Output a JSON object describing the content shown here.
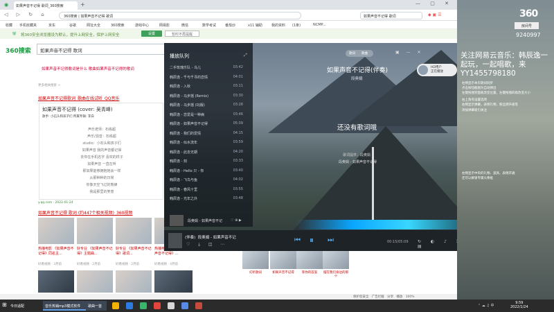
{
  "browser": {
    "tab_title": "如果声音不记得 歌词_360搜索",
    "address": "360搜索  |  如果声音不记得 歌词",
    "search_box": "如果声音不记得 歌词",
    "window_controls": "— ▢ ✕",
    "nav_icons": "◁ ▷ ↻ ⌂",
    "bookmarks": [
      "收藏",
      "手机收藏夹",
      "京东",
      "谷歌",
      "网址大全",
      "360搜索",
      "游戏中心",
      "网易影",
      "微信",
      "数学考试",
      "番茄炒",
      "x11 辅助",
      "我的资料",
      "(1条)",
      "NCMP..."
    ],
    "notice_text": "将360安全浏览器设为默认，提升上网安全，保护上网安全",
    "notice_btn1": "设置",
    "notice_btn2": "暂时不再提醒"
  },
  "search": {
    "logo": "360搜索",
    "query": "如果声音不记得 歌词",
    "related": "如果声音不记得歌词是什么  歌曲如果声音不记得的歌词",
    "related_small": "更多相关搜索 >",
    "result1_title": "如果声音不记得歌词_歌曲在线试听_QQ音乐",
    "lyrics_header": "如果声音不记得 (cover: 吴青峰)",
    "lyrics_sub": "歌手: 小石头和孩子们    所属专辑: 李白",
    "lyrics_lines": [
      "声乐老师：石栋超",
      "声乐/混音：石栋超",
      "studio：小石头和孩子们",
      "如果声音 我的声音都记得",
      "去你在手机名字 喜欢的样子",
      "如果声音 一直在听",
      "那如果能够拥抱她会一样",
      "从那种种的日常",
      "你像天空飞过的熊蜂",
      "我是那里的笑意"
    ],
    "result1_meta": "y.qq.com · 2022-01-24",
    "result2_title": "如果声音不记得 歌词 (约447个相关视频)_360视频",
    "video_captions": [
      "热播电影 《如果声音不记得》同名主...",
      "好专业 《如果声音不记得》主题曲...",
      "好专业 《如果声音不记得》歌词...",
      "热播电影 《如果声音不记得》..."
    ],
    "video_meta": [
      "好看视频 · 3月前",
      "好看视频 · 2月前",
      "好看视频 · 2月前",
      "好看视频 · 4月前"
    ],
    "right_cards": [
      "幻听歌词",
      "如果声音不记得",
      "等你的答案",
      "摆在我们身边的那个"
    ]
  },
  "player": {
    "playlist_header": "播放队列",
    "playlist": [
      {
        "title": "二手玫瑰乐队 - 乌儿",
        "dur": "03:42"
      },
      {
        "title": "韩辰逸 - 千与千寻的恋情",
        "dur": "04:01"
      },
      {
        "title": "韩辰逸 - 入秋",
        "dur": "03:11"
      },
      {
        "title": "韩辰逸 - 马步摇 (Remix)",
        "dur": "03:30"
      },
      {
        "title": "韩辰逸 - 马步摇 (DJ版)",
        "dur": "03:28"
      },
      {
        "title": "韩辰逸 - 恋爱是一种病",
        "dur": "03:46"
      },
      {
        "title": "韩辰逸 - 如果声音不记得",
        "dur": "05:09"
      },
      {
        "title": "韩辰逸 - 我们的爱情",
        "dur": "04:15"
      },
      {
        "title": "韩辰逸 - 似水流年",
        "dur": "03:59"
      },
      {
        "title": "韩辰逸 - 此去无期",
        "dur": "04:20"
      },
      {
        "title": "韩辰逸 - 刻",
        "dur": "03:33"
      },
      {
        "title": "韩辰逸 - Hello 只 - 你",
        "dur": "03:40"
      },
      {
        "title": "韩辰逸 - 飞鸟与鱼",
        "dur": "04:02"
      },
      {
        "title": "韩辰逸 - 春风十里",
        "dur": "03:55"
      },
      {
        "title": "韩辰逸 - 光年之外",
        "dur": "03:48"
      },
      {
        "title": "段奥娟 - 如果声音不记得",
        "dur": "05:09"
      }
    ],
    "mode_seg": [
      "歌词",
      "歌曲"
    ],
    "song_title": "如果声音不记得(伴奏)",
    "song_artist": "段奥娟",
    "current_lyric": "还没有歌词哦",
    "lyric_sub": "歌词提供：段奥娟",
    "lyric_next": "段奥娟 - 如果声音不记得",
    "user_name": "HD用户",
    "user_sub": "正在播放",
    "now_playing_label": "(伴奏)",
    "now_playing": "段奥娟 - 如果声音不记",
    "time": "00:15/05:09",
    "controls": [
      "⏮",
      "⏸",
      "⏭"
    ]
  },
  "overlay": {
    "logo": "360",
    "badge": "房间号",
    "room_no": "9240997",
    "title": "关注网易云音乐：韩辰逸一起玩，一起唱歌，来YY1455798180",
    "small_texts": [
      "右侧显示本页歌词同步",
      "点击按钮截图为自动弹出",
      "左键拖拽到面板改变位置，左键拖拽四角改变大小",
      "右上角有设置选项",
      "右侧显示弹幕，表情礼物，粉丝牌升级等",
      "添加弹幕吸引关注"
    ],
    "small_texts2": [
      "右侧显示中央的礼物、道具、表情开通",
      "还可以解锁专属头像框"
    ]
  },
  "taskbar": {
    "start_label": "今日适配",
    "items": [
      "您的位置: 首页",
      "正在播放",
      "更多..."
    ],
    "active": "音乐热销mp3模式软件",
    "active2": "歌曲一首",
    "status": [
      "保护您安全",
      "广告拦截",
      "分享",
      "播放",
      "100%"
    ],
    "time": "9:59",
    "date": "2022/1/24"
  }
}
